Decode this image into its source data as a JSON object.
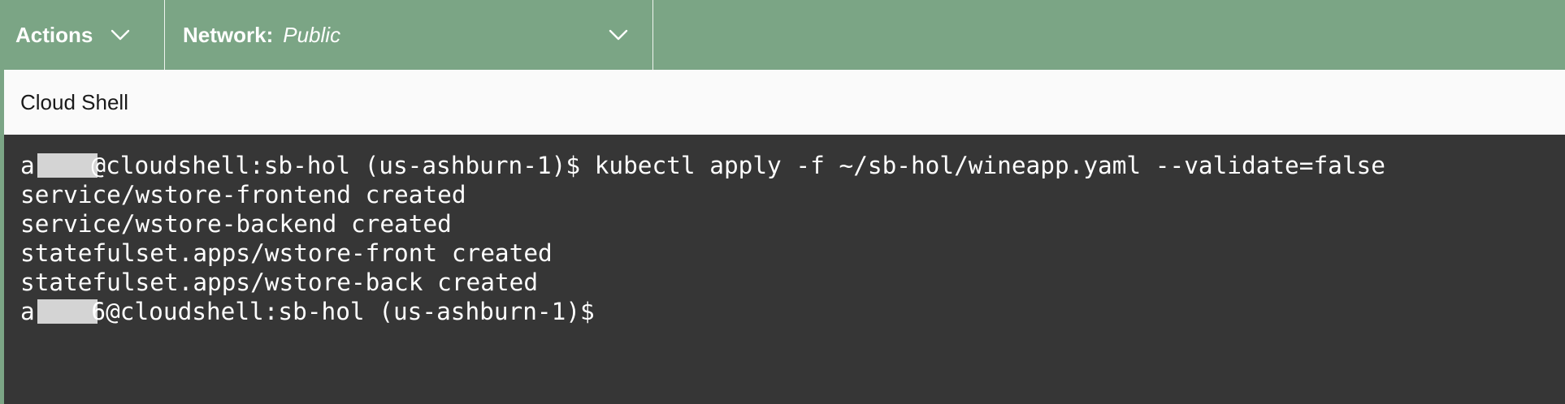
{
  "toolbar": {
    "actions_label": "Actions",
    "network_label": "Network:",
    "network_value": "Public",
    "icons": [
      "chevron-down-icon",
      "chevron-down-icon"
    ]
  },
  "panel": {
    "title": "Cloud Shell"
  },
  "terminal": {
    "prompt_user_start": "ar",
    "prompt_user_end_1": "",
    "prompt_user_end_2": "6",
    "prompt_host": "@cloudshell:sb-hol (us-ashburn-1)$",
    "command": " kubectl apply -f ~/sb-hol/wineapp.yaml --validate=false",
    "output": [
      "service/wstore-frontend created",
      "service/wstore-backend created",
      "statefulset.apps/wstore-front created",
      "statefulset.apps/wstore-back created"
    ]
  },
  "colors": {
    "toolbar_bg": "#7ba585",
    "terminal_bg": "#363636",
    "header_bg": "#fafafa",
    "redaction": "#d4d4d4"
  }
}
